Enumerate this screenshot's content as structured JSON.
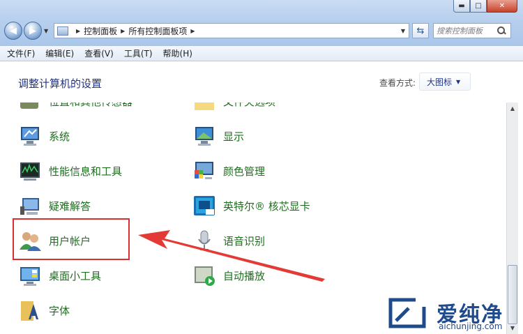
{
  "window": {
    "minimize_icon": "minimize-icon",
    "maximize_icon": "maximize-icon",
    "close_icon": "close-icon"
  },
  "address_bar": {
    "crumbs": [
      "控制面板",
      "所有控制面板项"
    ]
  },
  "search": {
    "placeholder": "搜索控制面板"
  },
  "menu": [
    "文件(F)",
    "编辑(E)",
    "查看(V)",
    "工具(T)",
    "帮助(H)"
  ],
  "header": {
    "title": "调整计算机的设置",
    "view_label": "查看方式:",
    "view_value": "大图标"
  },
  "items": {
    "top_left_clipped": "位置和其他传感器",
    "top_right_clipped": "文件夹选项",
    "left": [
      "系统",
      "性能信息和工具",
      "疑难解答",
      "用户帐户",
      "桌面小工具",
      "字体"
    ],
    "right": [
      "显示",
      "颜色管理",
      "英特尔® 核芯显卡",
      "语音识别",
      "自动播放"
    ]
  },
  "watermark": {
    "title": "爱纯净",
    "url": "aichunjing.com"
  },
  "colors": {
    "highlight": "#d82f2f",
    "link_green": "#1f6e1f",
    "title_blue": "#1e3287"
  }
}
